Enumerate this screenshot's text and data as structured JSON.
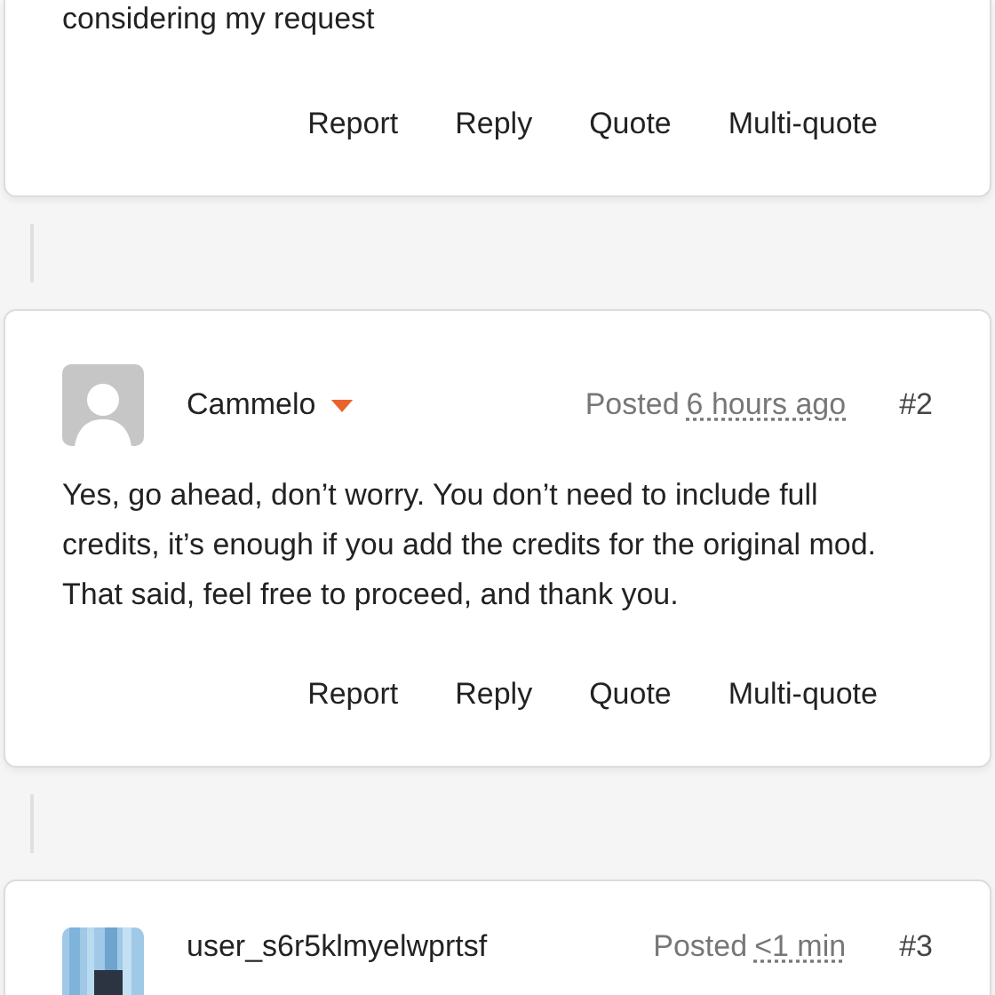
{
  "posts": [
    {
      "body": "considering my request",
      "actions": [
        "Report",
        "Reply",
        "Quote",
        "Multi-quote"
      ]
    },
    {
      "author": "Cammelo",
      "author_menu": true,
      "avatar": {
        "kind": "default"
      },
      "posted": "Posted",
      "time": "6 hours ago",
      "number": "#2",
      "body": "Yes, go ahead, don’t worry. You don’t need to include full credits, it’s enough if you add the credits for the original mod. That said, feel free to proceed, and thank you.",
      "actions": [
        "Report",
        "Reply",
        "Quote",
        "Multi-quote"
      ]
    },
    {
      "author": "user_s6r5klmyelwprtsf",
      "author_menu": false,
      "posted": "Posted",
      "time": "<1 min",
      "number": "#3"
    }
  ]
}
